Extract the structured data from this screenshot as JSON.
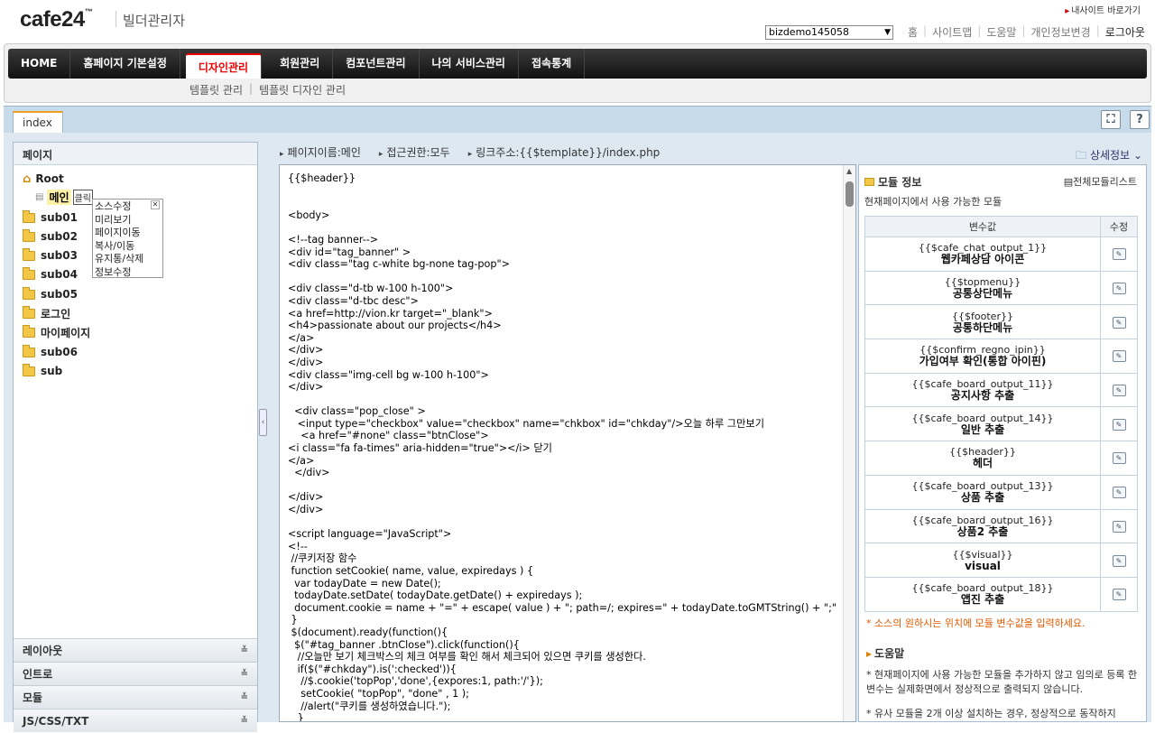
{
  "header": {
    "logo": "cafe24",
    "logo_tm": "™",
    "subtitle": "빌더관리자",
    "my_site": "내사이트 바로가기",
    "site_select": "bizdemo145058",
    "links": [
      "홈",
      "사이트맵",
      "도움말",
      "개인정보변경"
    ],
    "logout": "로그아웃"
  },
  "nav": {
    "items": [
      "HOME",
      "홈페이지 기본설정",
      "디자인관리",
      "회원관리",
      "컴포넌트관리",
      "나의 서비스관리",
      "접속통계"
    ],
    "active": "디자인관리",
    "sub": [
      "템플릿 관리",
      "템플릿 디자인 관리"
    ]
  },
  "tabbar": {
    "tab": "index",
    "fullscreen_icon": "fullscreen-icon",
    "help_label": "?"
  },
  "left": {
    "title": "페이지",
    "root": "Root",
    "main_label": "메인",
    "click_label": "클릭",
    "folders": [
      "sub01",
      "sub02",
      "sub03",
      "sub04",
      "sub05",
      "로그인",
      "마이페이지",
      "sub06",
      "sub"
    ],
    "context_menu": [
      "소스수정",
      "미리보기",
      "페이지이동",
      "복사/이동",
      "유지통/삭제",
      "정보수정"
    ],
    "accordions": [
      "레이아웃",
      "인트로",
      "모듈",
      "JS/CSS/TXT"
    ]
  },
  "info": {
    "page_name": "페이지이름:메인",
    "access": "접근권한:모두",
    "link": "링크주소:{{$template}}/index.php",
    "detail": "상세정보"
  },
  "code": "{{$header}}\n\n\n<body>\n\n<!--tag banner-->\n<div id=\"tag_banner\" >\n<div class=\"tag c-white bg-none tag-pop\">\n\n<div class=\"d-tb w-100 h-100\">\n<div class=\"d-tbc desc\">\n<a href=http://vion.kr target=\"_blank\">\n<h4>passionate about our projects</h4>\n</a>\n</div>\n</div>\n<div class=\"img-cell bg w-100 h-100\">\n</div>\n\n  <div class=\"pop_close\" >\n   <input type=\"checkbox\" value=\"checkbox\" name=\"chkbox\" id=\"chkday\"/>오늘 하루 그만보기\n    <a href=\"#none\" class=\"btnClose\">\n<i class=\"fa fa-times\" aria-hidden=\"true\"></i> 닫기\n</a>\n  </div>\n\n</div>\n</div>\n\n<script language=\"JavaScript\">\n<!--\n //쿠키저장 함수\n function setCookie( name, value, expiredays ) {\n  var todayDate = new Date();\n  todayDate.setDate( todayDate.getDate() + expiredays );\n  document.cookie = name + \"=\" + escape( value ) + \"; path=/; expires=\" + todayDate.toGMTString() + \";\"\n }\n $(document).ready(function(){\n  $(\"#tag_banner .btnClose\").click(function(){\n   //오늘만 보기 체크박스의 체크 여부를 확인 해서 체크되어 있으면 쿠키를 생성한다.\n   if($(\"#chkday\").is(':checked')){\n    //$.cookie('topPop','done',{expores:1, path:'/'});\n    setCookie( \"topPop\", \"done\" , 1 );\n    //alert(\"쿠키를 생성하였습니다.\");\n   }",
  "right": {
    "title": "모듈 정보",
    "all_list": "전체모듈리스트",
    "desc": "현재페이지에서 사용 가능한 모듈",
    "col_var": "변수값",
    "col_edit": "수정",
    "modules": [
      {
        "var": "{{$cafe_chat_output_1}}",
        "name": "웹카페상담 아이콘"
      },
      {
        "var": "{{$topmenu}}",
        "name": "공통상단메뉴"
      },
      {
        "var": "{{$footer}}",
        "name": "공통하단메뉴"
      },
      {
        "var": "{{$confirm_regno_ipin}}",
        "name": "가입여부 확인(통합 아이핀)"
      },
      {
        "var": "{{$cafe_board_output_11}}",
        "name": "공지사항 추출"
      },
      {
        "var": "{{$cafe_board_output_14}}",
        "name": "일반 추출"
      },
      {
        "var": "{{$header}}",
        "name": "헤더"
      },
      {
        "var": "{{$cafe_board_output_13}}",
        "name": "상품 추출"
      },
      {
        "var": "{{$cafe_board_output_16}}",
        "name": "상품2 추출"
      },
      {
        "var": "{{$visual}}",
        "name": "visual"
      },
      {
        "var": "{{$cafe_board_output_18}}",
        "name": "앱진 추출"
      }
    ],
    "note": "* 소스의 원하시는 위치에 모듈 변수값을 입력하세요.",
    "help_title": "도움말",
    "help": [
      "* 현재페이지에 사용 가능한 모듈을 추가하지 않고 임의로 등록 한 변수는 실제화면에서 정상적으로 출력되지 않습니다.",
      "* 유사 모듈을 2개 이상 설치하는 경우, 정상적으로 동작하지"
    ]
  }
}
